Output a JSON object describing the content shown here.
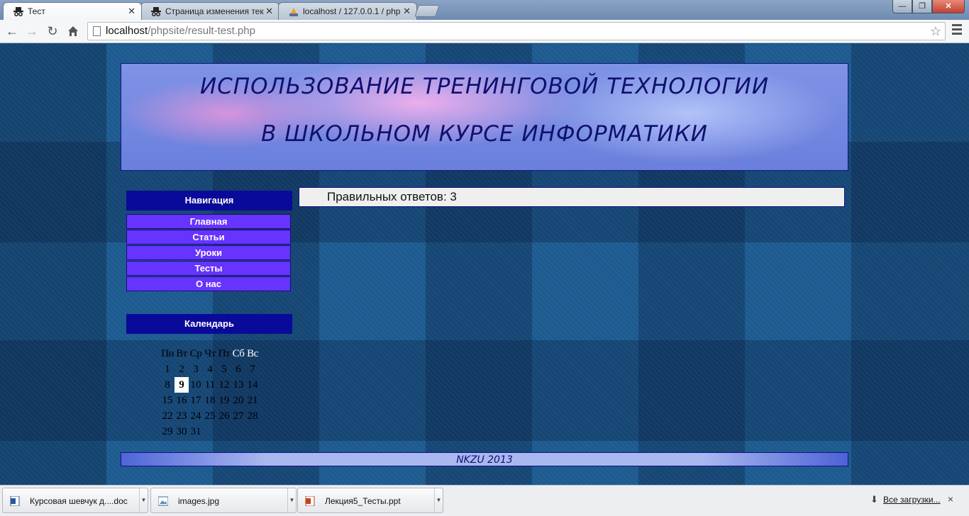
{
  "browser": {
    "tabs": [
      {
        "title": "Тест",
        "icon": "incognito-icon",
        "active": true
      },
      {
        "title": "Страница изменения тек",
        "icon": "incognito-icon",
        "active": false
      },
      {
        "title": "localhost / 127.0.0.1 / php",
        "icon": "phpmyadmin-icon",
        "active": false
      }
    ],
    "url_host": "localhost",
    "url_path": "/phpsite/result-test.php",
    "window_buttons": {
      "minimize": "—",
      "maximize": "❐",
      "close": "✕"
    }
  },
  "site": {
    "header": {
      "line1": "ИСПОЛЬЗОВАНИЕ ТРЕНИНГОВОЙ ТЕХНОЛОГИИ",
      "line2": "В ШКОЛЬНОМ КУРСЕ ИНФОРМАТИКИ"
    },
    "nav": {
      "title": "Навигация",
      "items": [
        "Главная",
        "Статьи",
        "Уроки",
        "Тесты",
        "О нас"
      ]
    },
    "calendar": {
      "title": "Календарь",
      "weekdays": [
        "Пн",
        "Вт",
        "Ср",
        "Чт",
        "Пт",
        "Сб",
        "Вс"
      ],
      "weeks": [
        [
          "1",
          "2",
          "3",
          "4",
          "5",
          "6",
          "7"
        ],
        [
          "8",
          "9",
          "10",
          "11",
          "12",
          "13",
          "14"
        ],
        [
          "15",
          "16",
          "17",
          "18",
          "19",
          "20",
          "21"
        ],
        [
          "22",
          "23",
          "24",
          "25",
          "26",
          "27",
          "28"
        ],
        [
          "29",
          "30",
          "31",
          "",
          "",
          "",
          ""
        ]
      ],
      "today": "9"
    },
    "result": {
      "label": "Правильных ответов:",
      "value": "3"
    },
    "footer": "NKZU 2013"
  },
  "downloads": {
    "items": [
      {
        "name": "Курсовая шевчук д....doc",
        "icon": "word-doc-icon"
      },
      {
        "name": "images.jpg",
        "icon": "image-file-icon"
      },
      {
        "name": "Лекция5_Тесты.ppt",
        "icon": "powerpoint-icon"
      }
    ],
    "show_all": "Все загрузки...",
    "close": "×"
  },
  "colors": {
    "nav_header": "#0a0a9a",
    "menu_item": "#6633ff",
    "header_text": "#10106e",
    "page_bg": "#1c5a8f"
  }
}
